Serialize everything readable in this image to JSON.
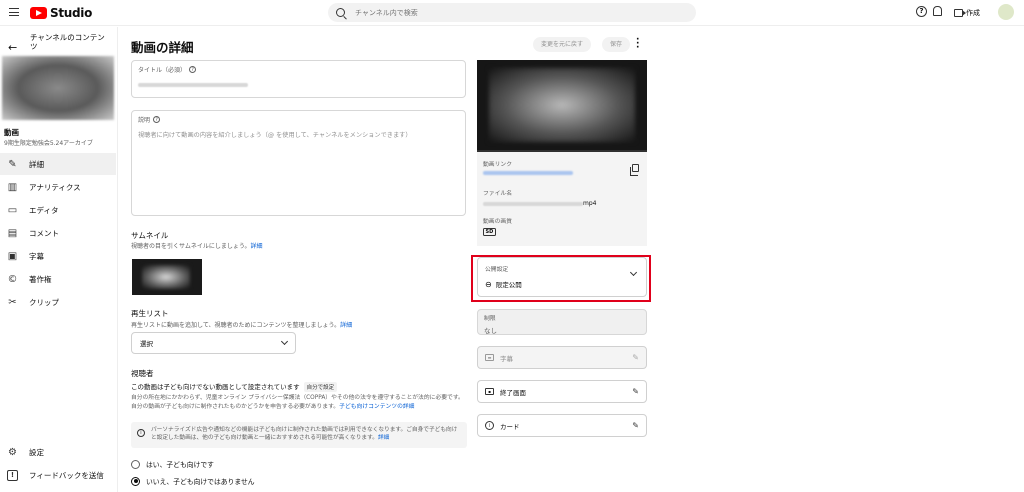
{
  "topbar": {
    "logo_text": "Studio",
    "search_placeholder": "チャンネル内で検索",
    "help_glyph": "?",
    "create_label": "作成"
  },
  "sidebar": {
    "back_glyph": "←",
    "title": "チャンネルのコンテンツ",
    "video_label": "動画",
    "video_name": "9期生限定勉強会5.24アーカイブ",
    "items": [
      {
        "label": "詳細",
        "icon": "pencil-icon",
        "glyph": "✎",
        "active": true
      },
      {
        "label": "アナリティクス",
        "icon": "analytics-icon",
        "glyph": "▥",
        "active": false
      },
      {
        "label": "エディタ",
        "icon": "editor-icon",
        "glyph": "▭",
        "active": false
      },
      {
        "label": "コメント",
        "icon": "comment-icon",
        "glyph": "▤",
        "active": false
      },
      {
        "label": "字幕",
        "icon": "subtitles-icon",
        "glyph": "▣",
        "active": false
      },
      {
        "label": "著作権",
        "icon": "copyright-icon",
        "glyph": "©",
        "active": false
      },
      {
        "label": "クリップ",
        "icon": "scissors-icon",
        "glyph": "✂",
        "active": false
      }
    ],
    "bottom_items": [
      {
        "label": "設定",
        "icon": "gear-icon",
        "glyph": "⚙"
      },
      {
        "label": "フィードバックを送信",
        "icon": "feedback-icon",
        "glyph": "!"
      }
    ]
  },
  "main": {
    "page_title": "動画の詳細",
    "undo_label": "変更を元に戻す",
    "save_label": "保存",
    "title_field": {
      "label": "タイトル（必須）"
    },
    "description_field": {
      "label": "説明",
      "placeholder": "視聴者に向けて動画の内容を紹介しましょう（@ を使用して、チャンネルをメンションできます）"
    },
    "thumbnail": {
      "heading": "サムネイル",
      "sub": "視聴者の目を引くサムネイルにしましょう。",
      "link": "詳細"
    },
    "playlist": {
      "heading": "再生リスト",
      "sub": "再生リストに動画を追加して、視聴者のためにコンテンツを整理しましょう。",
      "link": "詳細",
      "select_value": "選択"
    },
    "audience": {
      "heading": "視聴者",
      "status": "この動画は子ども向けでない動画として設定されています",
      "badge": "自分で設定",
      "body": "自分の所在地にかかわらず、児童オンライン プライバシー保護法（COPPA）やその他の法令を遵守することが法的に必要です。自分の動画が子ども向けに制作されたものかどうかを申告する必要があります。",
      "body_link": "子ども向けコンテンツの詳細",
      "info_glyph": "i",
      "info": "パーソナライズド広告や通知などの機能は子ども向けに制作された動画では利用できなくなります。ご自身で子ども向けと設定した動画は、他の子ども向け動画と一緒におすすめされる可能性が高くなります。",
      "info_link": "詳細",
      "option_yes": "はい、子ども向けです",
      "option_no": "いいえ、子ども向けではありません"
    }
  },
  "right": {
    "video_link_label": "動画リンク",
    "filename_label": "ファイル名",
    "filename_ext": "mp4",
    "quality_label": "動画の画質",
    "quality_badge": "SD",
    "visibility_label": "公開設定",
    "visibility_glyph": "⊖",
    "visibility_value": "限定公開",
    "restriction_label": "制限",
    "restriction_value": "なし",
    "subtitles_label": "字幕",
    "end_screen_label": "終了画面",
    "cards_label": "カード",
    "cards_glyph": "i",
    "edit_glyph": "✎"
  }
}
